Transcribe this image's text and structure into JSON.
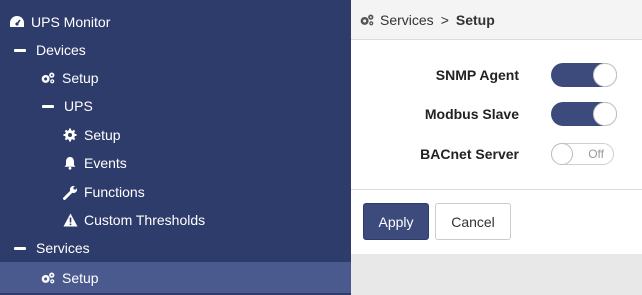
{
  "sidebar": {
    "app_title": "UPS Monitor",
    "devices_label": "Devices",
    "devices_setup_label": "Setup",
    "ups_label": "UPS",
    "ups_setup_label": "Setup",
    "events_label": "Events",
    "functions_label": "Functions",
    "custom_thresholds_label": "Custom Thresholds",
    "services_label": "Services",
    "services_setup_label": "Setup"
  },
  "breadcrumb": {
    "parent": "Services",
    "separator": ">",
    "current": "Setup"
  },
  "settings": [
    {
      "label": "SNMP Agent",
      "state": "on"
    },
    {
      "label": "Modbus Slave",
      "state": "on"
    },
    {
      "label": "BACnet Server",
      "state": "off",
      "state_label": "Off"
    }
  ],
  "buttons": {
    "apply_label": "Apply",
    "cancel_label": "Cancel"
  },
  "colors": {
    "sidebar_bg": "#2e3c6b",
    "sidebar_active_bg": "#4a5a8e",
    "accent": "#3c4b7c"
  },
  "icons": {
    "app": "dashboard-icon",
    "devices_setup": "cogs-icon",
    "ups_setup": "gear-icon",
    "events": "bell-icon",
    "functions": "wrench-icon",
    "custom_thresholds": "warning-icon",
    "services_setup": "cogs-icon",
    "breadcrumb": "cogs-icon"
  }
}
